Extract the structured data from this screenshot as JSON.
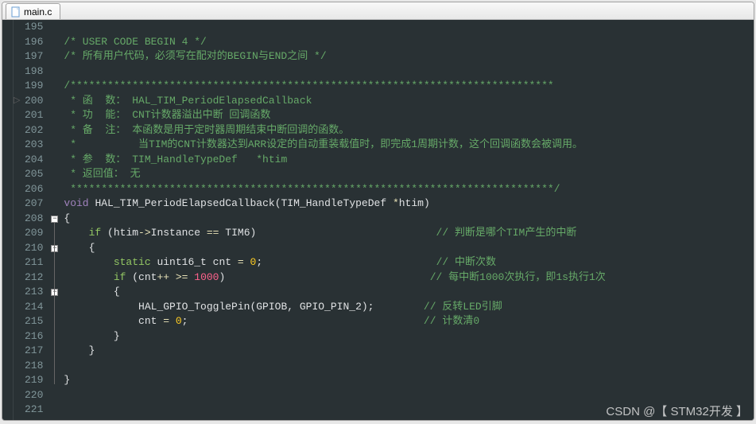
{
  "tab": {
    "filename": "main.c"
  },
  "gutter": {
    "start": 195,
    "end": 221
  },
  "code": {
    "lines": [
      {
        "n": 195,
        "segs": [
          {
            "t": "",
            "cls": ""
          }
        ]
      },
      {
        "n": 196,
        "segs": [
          {
            "t": "/* USER CODE BEGIN 4 */",
            "cls": "c-comment"
          }
        ]
      },
      {
        "n": 197,
        "segs": [
          {
            "t": "/* 所有用户代码，必须写在配对的BEGIN与END之间 */",
            "cls": "c-comment"
          }
        ]
      },
      {
        "n": 198,
        "segs": [
          {
            "t": "",
            "cls": ""
          }
        ]
      },
      {
        "n": 199,
        "segs": [
          {
            "t": "/******************************************************************************",
            "cls": "c-comment"
          }
        ]
      },
      {
        "n": 200,
        "segs": [
          {
            "t": " * 函  数： HAL_TIM_PeriodElapsedCallback",
            "cls": "c-comment"
          }
        ]
      },
      {
        "n": 201,
        "segs": [
          {
            "t": " * 功  能： CNT计数器溢出中断 回调函数",
            "cls": "c-comment"
          }
        ]
      },
      {
        "n": 202,
        "segs": [
          {
            "t": " * 备  注： 本函数是用于定时器周期结束中断回调的函数。",
            "cls": "c-comment"
          }
        ]
      },
      {
        "n": 203,
        "segs": [
          {
            "t": " *          当TIM的CNT计数器达到ARR设定的自动重装载值时，即完成1周期计数，这个回调函数会被调用。",
            "cls": "c-comment"
          }
        ]
      },
      {
        "n": 204,
        "segs": [
          {
            "t": " * 参  数： TIM_HandleTypeDef   *htim",
            "cls": "c-comment"
          }
        ]
      },
      {
        "n": 205,
        "segs": [
          {
            "t": " * 返回值： 无",
            "cls": "c-comment"
          }
        ]
      },
      {
        "n": 206,
        "segs": [
          {
            "t": " ******************************************************************************/",
            "cls": "c-comment"
          }
        ]
      },
      {
        "n": 207,
        "segs": [
          {
            "t": "void",
            "cls": "c-type"
          },
          {
            "t": " ",
            "cls": ""
          },
          {
            "t": "HAL_TIM_PeriodElapsedCallback",
            "cls": "c-func"
          },
          {
            "t": "(",
            "cls": "c-punct"
          },
          {
            "t": "TIM_HandleTypeDef ",
            "cls": "c-default"
          },
          {
            "t": "*",
            "cls": "c-op"
          },
          {
            "t": "htim",
            "cls": "c-default"
          },
          {
            "t": ")",
            "cls": "c-punct"
          }
        ]
      },
      {
        "n": 208,
        "segs": [
          {
            "t": "{",
            "cls": "c-punct"
          }
        ],
        "fold": "open"
      },
      {
        "n": 209,
        "segs": [
          {
            "t": "    ",
            "cls": ""
          },
          {
            "t": "if",
            "cls": "c-keyword"
          },
          {
            "t": " (htim",
            "cls": "c-default"
          },
          {
            "t": "->",
            "cls": "c-op"
          },
          {
            "t": "Instance ",
            "cls": "c-default"
          },
          {
            "t": "==",
            "cls": "c-op"
          },
          {
            "t": " TIM6)                             ",
            "cls": "c-default"
          },
          {
            "t": "// 判断是哪个TIM产生的中断",
            "cls": "c-comment"
          }
        ]
      },
      {
        "n": 210,
        "segs": [
          {
            "t": "    {",
            "cls": "c-punct"
          }
        ],
        "fold": "open"
      },
      {
        "n": 211,
        "segs": [
          {
            "t": "        ",
            "cls": ""
          },
          {
            "t": "static",
            "cls": "c-keyword"
          },
          {
            "t": " ",
            "cls": ""
          },
          {
            "t": "uint16_t",
            "cls": "c-default"
          },
          {
            "t": " cnt ",
            "cls": "c-default"
          },
          {
            "t": "=",
            "cls": "c-op"
          },
          {
            "t": " ",
            "cls": ""
          },
          {
            "t": "0",
            "cls": "c-num"
          },
          {
            "t": ";                            ",
            "cls": "c-punct"
          },
          {
            "t": "// 中断次数",
            "cls": "c-comment"
          }
        ]
      },
      {
        "n": 212,
        "segs": [
          {
            "t": "        ",
            "cls": ""
          },
          {
            "t": "if",
            "cls": "c-keyword"
          },
          {
            "t": " (cnt",
            "cls": "c-default"
          },
          {
            "t": "++ >=",
            "cls": "c-op"
          },
          {
            "t": " ",
            "cls": ""
          },
          {
            "t": "1000",
            "cls": "c-num-pink"
          },
          {
            "t": ")                                 ",
            "cls": "c-default"
          },
          {
            "t": "// 每中断1000次执行，即1s执行1次",
            "cls": "c-comment"
          }
        ]
      },
      {
        "n": 213,
        "segs": [
          {
            "t": "        {",
            "cls": "c-punct"
          }
        ],
        "fold": "open"
      },
      {
        "n": 214,
        "segs": [
          {
            "t": "            HAL_GPIO_TogglePin(GPIOB, GPIO_PIN_2);        ",
            "cls": "c-default"
          },
          {
            "t": "// 反转LED引脚",
            "cls": "c-comment"
          }
        ]
      },
      {
        "n": 215,
        "segs": [
          {
            "t": "            cnt ",
            "cls": "c-default"
          },
          {
            "t": "=",
            "cls": "c-op"
          },
          {
            "t": " ",
            "cls": ""
          },
          {
            "t": "0",
            "cls": "c-num"
          },
          {
            "t": ";                                      ",
            "cls": "c-punct"
          },
          {
            "t": "// 计数清0",
            "cls": "c-comment"
          }
        ]
      },
      {
        "n": 216,
        "segs": [
          {
            "t": "        }",
            "cls": "c-punct"
          }
        ]
      },
      {
        "n": 217,
        "segs": [
          {
            "t": "    }",
            "cls": "c-punct"
          }
        ]
      },
      {
        "n": 218,
        "segs": [
          {
            "t": "",
            "cls": ""
          }
        ]
      },
      {
        "n": 219,
        "segs": [
          {
            "t": "}",
            "cls": "c-punct"
          }
        ]
      },
      {
        "n": 220,
        "segs": [
          {
            "t": "",
            "cls": ""
          }
        ]
      },
      {
        "n": 221,
        "segs": [
          {
            "t": "",
            "cls": ""
          }
        ]
      }
    ]
  },
  "watermark": "CSDN @【 STM32开发 】"
}
